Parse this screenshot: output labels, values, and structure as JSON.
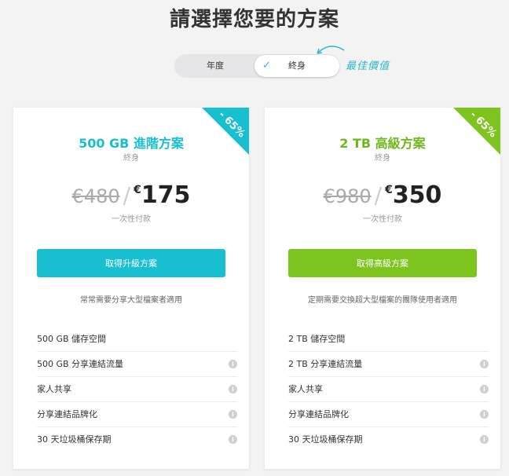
{
  "page": {
    "title": "請選擇您要的方案"
  },
  "toggle": {
    "annual_label": "年度",
    "lifetime_label": "終身",
    "best_value": "最佳價值"
  },
  "plans": [
    {
      "discount": "- 65%",
      "name": "500 GB 進階方案",
      "period": "終身",
      "old_price": "€480",
      "currency": "€",
      "price": "175",
      "payment_note": "一次性付款",
      "cta_label": "取得升級方案",
      "audience": "常常需要分享大型檔案者適用",
      "features": [
        "500 GB 儲存空間",
        "500 GB 分享連結流量",
        "家人共享",
        "分享連結品牌化",
        "30 天垃圾桶保存期"
      ],
      "accent": "#17bfd1"
    },
    {
      "discount": "- 65%",
      "name": "2 TB 高級方案",
      "period": "終身",
      "old_price": "€980",
      "currency": "€",
      "price": "350",
      "payment_note": "一次性付款",
      "cta_label": "取得高級方案",
      "audience": "定期需要交換超大型檔案的團隊使用者適用",
      "features": [
        "2 TB 儲存空間",
        "2 TB 分享連結流量",
        "家人共享",
        "分享連結品牌化",
        "30 天垃圾桶保存期"
      ],
      "accent": "#7ec41e"
    }
  ],
  "icons": {
    "check": "check-icon",
    "info": "info-icon",
    "arrow": "curved-arrow-icon"
  }
}
